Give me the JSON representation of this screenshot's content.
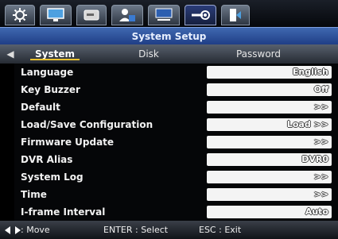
{
  "window": {
    "title": "System Setup"
  },
  "menu_icons": [
    {
      "name": "gear-icon"
    },
    {
      "name": "monitor-icon"
    },
    {
      "name": "hdd-icon"
    },
    {
      "name": "users-icon"
    },
    {
      "name": "network-icon"
    },
    {
      "name": "system-settings-icon"
    },
    {
      "name": "exit-icon"
    }
  ],
  "tabs": [
    {
      "label": "System",
      "active": true
    },
    {
      "label": "Disk",
      "active": false
    },
    {
      "label": "Password",
      "active": false
    }
  ],
  "settings": [
    {
      "label": "Language",
      "value": "English"
    },
    {
      "label": "Key Buzzer",
      "value": "Off"
    },
    {
      "label": "Default",
      "value": ">>"
    },
    {
      "label": "Load/Save Configuration",
      "value": "Load >>"
    },
    {
      "label": "Firmware Update",
      "value": ">>"
    },
    {
      "label": "DVR Alias",
      "value": "DVR0"
    },
    {
      "label": "System Log",
      "value": ">>"
    },
    {
      "label": "Time",
      "value": ">>"
    },
    {
      "label": "I-frame Interval",
      "value": "Auto"
    }
  ],
  "footer": {
    "move": ": Move",
    "select": "ENTER : Select",
    "exit": "ESC : Exit"
  },
  "colors": {
    "title_bar": "#2d52a0",
    "tab_underline": "#e8c030",
    "value_box": "#f4f4f4"
  }
}
